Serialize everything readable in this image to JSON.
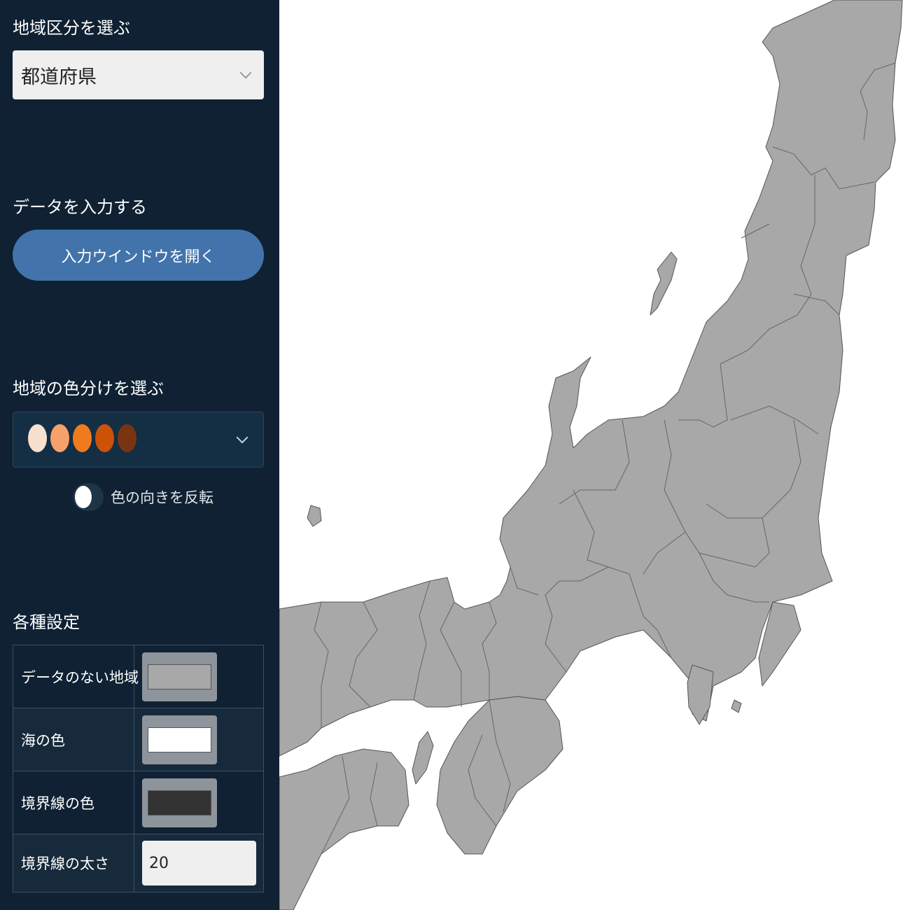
{
  "sidebar": {
    "region_section": {
      "title": "地域区分を選ぶ",
      "selected": "都道府県"
    },
    "data_section": {
      "title": "データを入力する",
      "open_button": "入力ウインドウを開く"
    },
    "palette_section": {
      "title": "地域の色分けを選ぶ",
      "swatches": [
        "#f8e0cf",
        "#f6a06a",
        "#f07b1f",
        "#cc5208",
        "#7a3411"
      ],
      "reverse_label": "色の向きを反転",
      "reverse_on": false
    },
    "settings_section": {
      "title": "各種設定",
      "no_data_label": "データのない地域",
      "no_data_color": "#a8a8a8",
      "sea_label": "海の色",
      "sea_color": "#ffffff",
      "border_color_label": "境界線の色",
      "border_color": "#333333",
      "border_width_label": "境界線の太さ",
      "border_width": "20"
    }
  },
  "map": {
    "land_color": "#a8a8a8",
    "sea_color": "#ffffff",
    "border_color": "#555555"
  }
}
